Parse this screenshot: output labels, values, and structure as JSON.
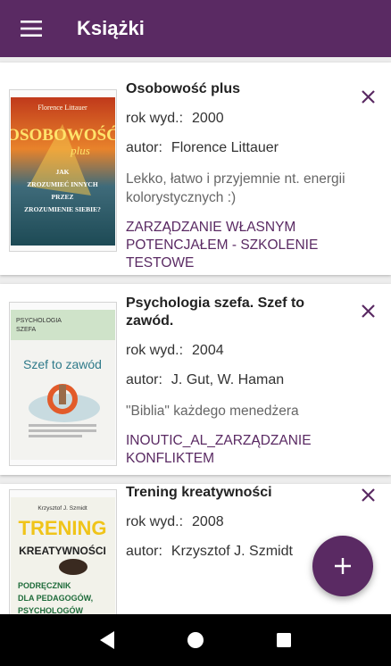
{
  "appbar": {
    "title": "Książki",
    "menu_icon": "menu-icon"
  },
  "books": [
    {
      "title": "Osobowość plus",
      "year_label": "rok wyd.:",
      "year": "2000",
      "author_label": "autor:",
      "author": "Florence Littauer",
      "description": "Lekko, łatwo i przyjemnie nt. energii kolorystycznych :)",
      "category": "ZARZĄDZANIE WŁASNYM POTENCJAŁEM - SZKOLENIE TESTOWE",
      "cover": {
        "author": "Florence Littauer",
        "title": "OSOBOWOŚĆ",
        "title2": "plus",
        "subtitle": "JAK ZROZUMIEĆ INNYCH PRZEZ ZROZUMIENIE SIEBIE?"
      }
    },
    {
      "title": "Psychologia szefa. Szef to zawód.",
      "year_label": "rok wyd.:",
      "year": "2004",
      "author_label": "autor:",
      "author": "J. Gut, W. Haman",
      "description": "\"Biblia\" każdego menedżera",
      "category": "INOUTIC_AL_ZARZĄDZANIE KONFLIKTEM",
      "cover": {
        "series": "PSYCHOLOGIA SZEFA",
        "title": "Szef to zawód"
      }
    },
    {
      "title": "Trening kreatywności",
      "year_label": "rok wyd.:",
      "year": "2008",
      "author_label": "autor:",
      "author": "Krzysztof J. Szmidt",
      "cover": {
        "author": "Krzysztof J. Szmidt",
        "title": "TRENING",
        "title2": "KREATYWNOŚCI",
        "subtitle": "PODRĘCZNIK DLA PEDAGOGÓW, PSYCHOLOGÓW I TRENERÓW"
      }
    }
  ],
  "fab": {
    "icon": "plus-icon"
  },
  "colors": {
    "primary": "#5a2a63",
    "background": "#ededed"
  }
}
